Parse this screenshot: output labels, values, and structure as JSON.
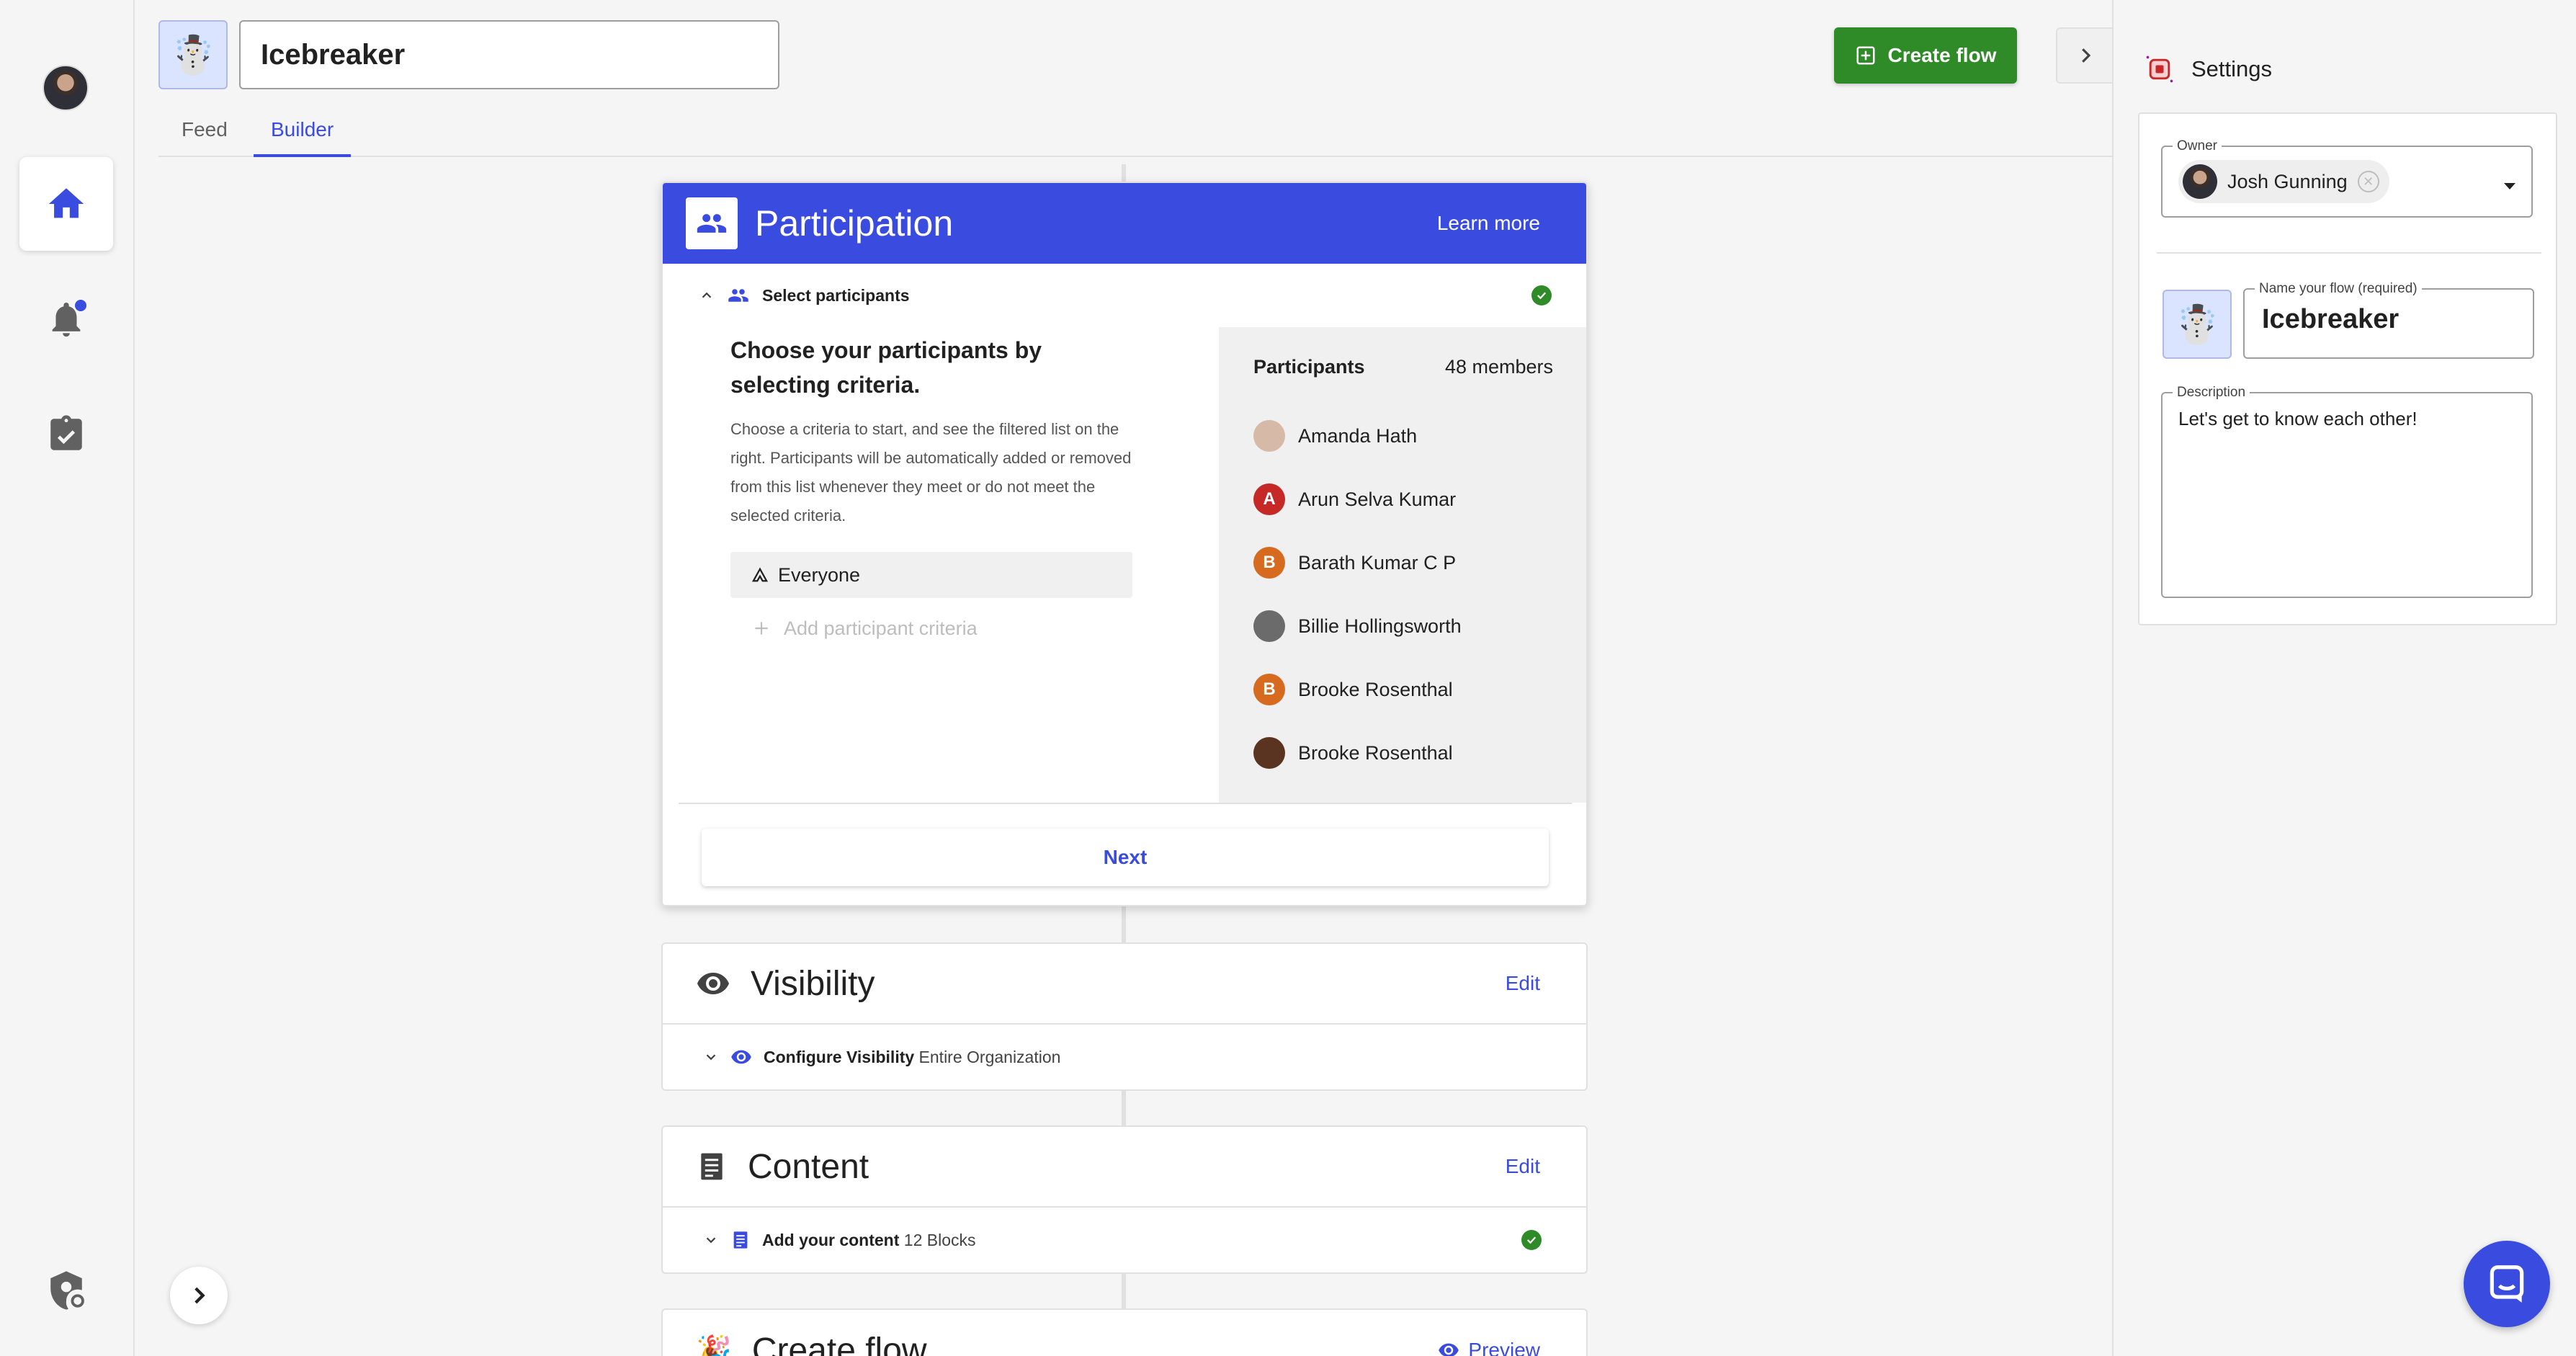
{
  "flow": {
    "emoji": "☃️",
    "title": "Icebreaker"
  },
  "tabs": [
    {
      "label": "Feed"
    },
    {
      "label": "Builder"
    }
  ],
  "header": {
    "create_flow_label": "Create flow"
  },
  "participation": {
    "title": "Participation",
    "learn_more": "Learn more",
    "sub_label": "Select participants",
    "heading": "Choose your participants by selecting criteria.",
    "description": "Choose a criteria to start, and see the filtered list on the right. Participants will be automatically added or removed from this list whenever they meet or do not meet the selected criteria.",
    "criteria": "Everyone",
    "add_criteria": "Add participant criteria",
    "participants_label": "Participants",
    "members_count": "48 members",
    "people": [
      {
        "name": "Amanda Hath",
        "initial": "",
        "color": "#d7b9a8"
      },
      {
        "name": "Arun Selva Kumar",
        "initial": "A",
        "color": "#c62828"
      },
      {
        "name": "Barath Kumar C P",
        "initial": "B",
        "color": "#d66a1f"
      },
      {
        "name": "Billie Hollingsworth",
        "initial": "",
        "color": "#6b6b6b"
      },
      {
        "name": "Brooke Rosenthal",
        "initial": "B",
        "color": "#d66a1f"
      },
      {
        "name": "Brooke Rosenthal",
        "initial": "",
        "color": "#5a3420"
      }
    ],
    "next_label": "Next"
  },
  "visibility": {
    "title": "Visibility",
    "edit": "Edit",
    "sub_label": "Configure Visibility",
    "sub_value": "Entire Organization"
  },
  "content": {
    "title": "Content",
    "edit": "Edit",
    "sub_label": "Add your content",
    "sub_value": "12 Blocks"
  },
  "create_flow": {
    "title": "Create flow",
    "preview": "Preview"
  },
  "settings": {
    "title": "Settings",
    "owner_label": "Owner",
    "owner_name": "Josh Gunning",
    "name_label": "Name your flow (required)",
    "name_value": "Icebreaker",
    "description_label": "Description",
    "description_value": "Let's get to know each other!"
  },
  "colors": {
    "accent": "#3a4be0",
    "success": "#2e8b27"
  }
}
